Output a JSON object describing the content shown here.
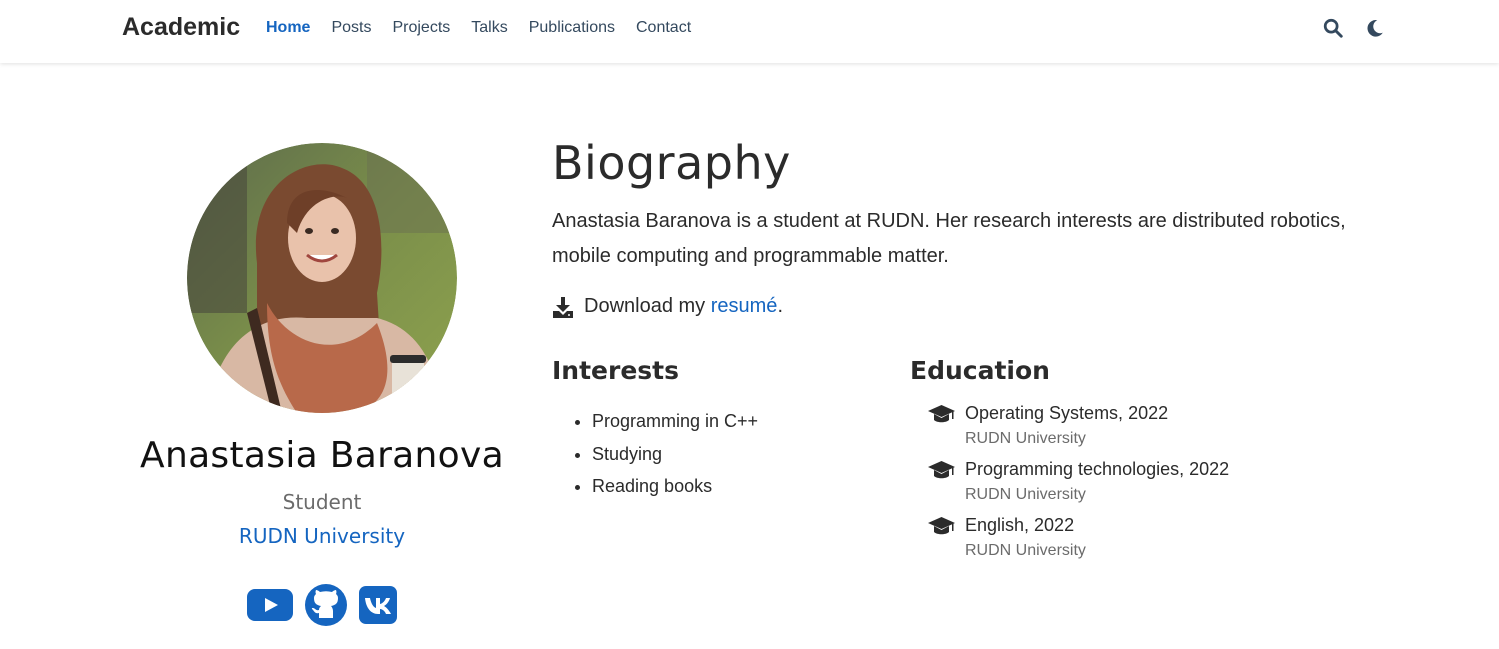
{
  "navbar": {
    "brand": "Academic",
    "links": [
      {
        "label": "Home",
        "active": true
      },
      {
        "label": "Posts"
      },
      {
        "label": "Projects"
      },
      {
        "label": "Talks"
      },
      {
        "label": "Publications"
      },
      {
        "label": "Contact"
      }
    ],
    "tools": [
      "search-icon",
      "moon-icon"
    ]
  },
  "profile": {
    "name": "Anastasia Baranova",
    "role": "Student",
    "organization": "RUDN University",
    "social": [
      "youtube-icon",
      "github-icon",
      "vk-icon"
    ]
  },
  "biography": {
    "title": "Biography",
    "text": "Anastasia Baranova is a student at RUDN. Her research interests are distributed robotics, mobile computing and programmable matter.",
    "download_prefix": "Download my ",
    "download_link": "resumé",
    "download_suffix": "."
  },
  "interests": {
    "title": "Interests",
    "items": [
      "Programming in C++",
      "Studying",
      "Reading books"
    ]
  },
  "education": {
    "title": "Education",
    "items": [
      {
        "course": "Operating Systems, 2022",
        "institution": "RUDN University"
      },
      {
        "course": "Programming technologies, 2022",
        "institution": "RUDN University"
      },
      {
        "course": "English, 2022",
        "institution": "RUDN University"
      }
    ]
  },
  "colors": {
    "accent": "#1565c0",
    "text": "#2b2b2b",
    "muted": "#6b6b6b"
  }
}
